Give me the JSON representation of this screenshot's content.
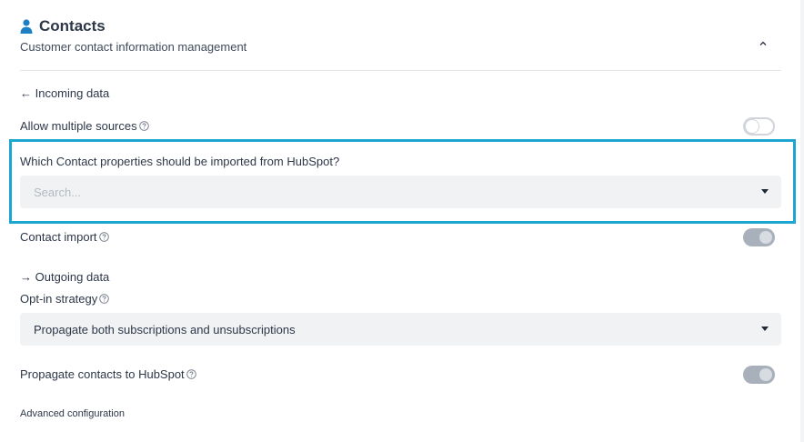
{
  "section": {
    "title": "Contacts",
    "subtitle": "Customer contact information management"
  },
  "incoming": {
    "heading": "← Incoming data",
    "allow_multiple_sources_label": "Allow multiple sources",
    "allow_multiple_sources_enabled": false,
    "properties_question": "Which Contact properties should be imported from HubSpot?",
    "properties_placeholder": "Search...",
    "contact_import_label": "Contact import",
    "contact_import_enabled": true
  },
  "outgoing": {
    "heading": "→ Outgoing data",
    "opt_in_strategy_label": "Opt-in strategy",
    "opt_in_strategy_value": "Propagate both subscriptions and unsubscriptions",
    "propagate_contacts_label": "Propagate contacts to HubSpot",
    "propagate_contacts_enabled": true
  },
  "advanced_link": "Advanced configuration",
  "colors": {
    "highlight_border": "#1ea6d3",
    "icon_blue": "#1f7fc4",
    "toggle_disabled": "#a8b0bb"
  },
  "icons": {
    "section": "person-icon",
    "collapse": "chevron-up-icon",
    "help": "help-circle-icon",
    "dropdown": "caret-down-icon"
  }
}
